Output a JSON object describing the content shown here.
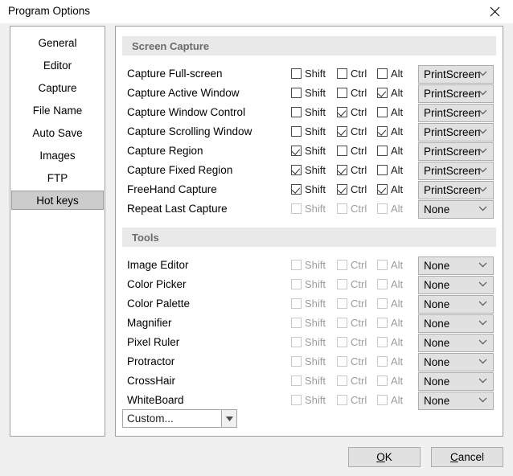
{
  "window": {
    "title": "Program Options",
    "close_icon": "close-icon"
  },
  "sidebar": {
    "items": [
      {
        "label": "General",
        "selected": false
      },
      {
        "label": "Editor",
        "selected": false
      },
      {
        "label": "Capture",
        "selected": false
      },
      {
        "label": "File Name",
        "selected": false
      },
      {
        "label": "Auto Save",
        "selected": false
      },
      {
        "label": "Images",
        "selected": false
      },
      {
        "label": "FTP",
        "selected": false
      },
      {
        "label": "Hot keys",
        "selected": true
      }
    ]
  },
  "modifiers": {
    "shift_label": "Shift",
    "ctrl_label": "Ctrl",
    "alt_label": "Alt"
  },
  "sections": [
    {
      "title": "Screen Capture",
      "rows": [
        {
          "label": "Capture Full-screen",
          "shift": false,
          "ctrl": false,
          "alt": false,
          "enabled": true,
          "key": "PrintScreen"
        },
        {
          "label": "Capture Active Window",
          "shift": false,
          "ctrl": false,
          "alt": true,
          "enabled": true,
          "key": "PrintScreen"
        },
        {
          "label": "Capture Window Control",
          "shift": false,
          "ctrl": true,
          "alt": false,
          "enabled": true,
          "key": "PrintScreen"
        },
        {
          "label": "Capture Scrolling Window",
          "shift": false,
          "ctrl": true,
          "alt": true,
          "enabled": true,
          "key": "PrintScreen"
        },
        {
          "label": "Capture Region",
          "shift": true,
          "ctrl": false,
          "alt": false,
          "enabled": true,
          "key": "PrintScreen"
        },
        {
          "label": "Capture Fixed Region",
          "shift": true,
          "ctrl": true,
          "alt": false,
          "enabled": true,
          "key": "PrintScreen"
        },
        {
          "label": "FreeHand Capture",
          "shift": true,
          "ctrl": true,
          "alt": true,
          "enabled": true,
          "key": "PrintScreen"
        },
        {
          "label": "Repeat Last Capture",
          "shift": false,
          "ctrl": false,
          "alt": false,
          "enabled": false,
          "key": "None"
        }
      ]
    },
    {
      "title": "Tools",
      "rows": [
        {
          "label": "Image Editor",
          "shift": false,
          "ctrl": false,
          "alt": false,
          "enabled": false,
          "key": "None"
        },
        {
          "label": "Color Picker",
          "shift": false,
          "ctrl": false,
          "alt": false,
          "enabled": false,
          "key": "None"
        },
        {
          "label": "Color Palette",
          "shift": false,
          "ctrl": false,
          "alt": false,
          "enabled": false,
          "key": "None"
        },
        {
          "label": "Magnifier",
          "shift": false,
          "ctrl": false,
          "alt": false,
          "enabled": false,
          "key": "None"
        },
        {
          "label": "Pixel Ruler",
          "shift": false,
          "ctrl": false,
          "alt": false,
          "enabled": false,
          "key": "None"
        },
        {
          "label": "Protractor",
          "shift": false,
          "ctrl": false,
          "alt": false,
          "enabled": false,
          "key": "None"
        },
        {
          "label": "CrossHair",
          "shift": false,
          "ctrl": false,
          "alt": false,
          "enabled": false,
          "key": "None"
        },
        {
          "label": "WhiteBoard",
          "shift": false,
          "ctrl": false,
          "alt": false,
          "enabled": false,
          "key": "None"
        }
      ]
    }
  ],
  "preset_combo": {
    "value": "Custom...",
    "chevron_icon": "chevron-down-icon"
  },
  "footer": {
    "ok": {
      "accel": "O",
      "rest": "K"
    },
    "cancel": {
      "accel": "C",
      "rest": "ancel"
    }
  },
  "colors": {
    "dialog_bg": "#f0f0f0",
    "panel_bg": "#ffffff",
    "panel_border": "#a0a0a0",
    "section_header_bg": "#e9e9e9",
    "section_header_text": "#6b6b6b",
    "selected_item_bg": "#cccccc",
    "combo_bg": "#e1e1e1",
    "combo_border": "#adadad",
    "disabled_text": "#9d9d9d"
  }
}
